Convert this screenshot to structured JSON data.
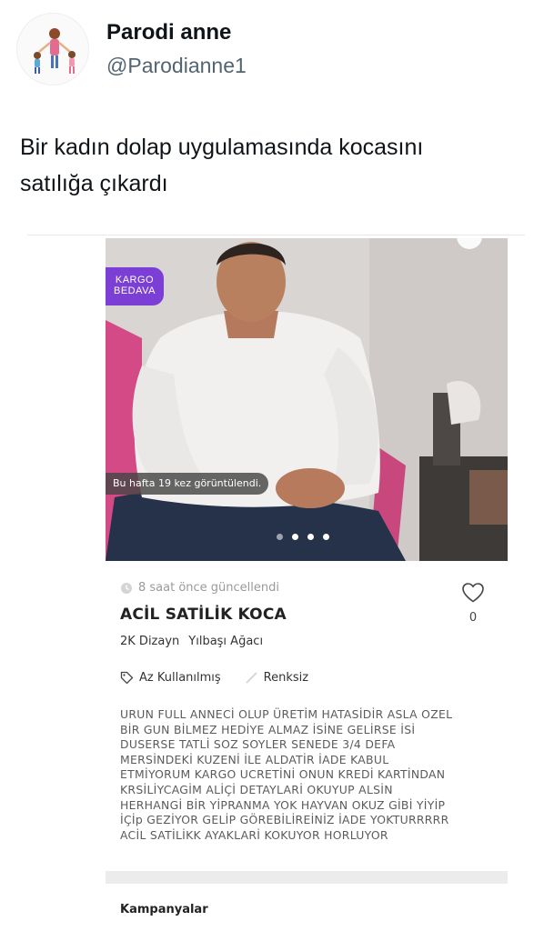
{
  "tweet": {
    "display_name": "Parodi anne",
    "handle": "@Parodianne1",
    "text_line1": "Bir kadın dolap uygulamasında kocasını",
    "text_line2": "satılığa çıkardı"
  },
  "listing": {
    "badge_line1": "KARGO",
    "badge_line2": "BEDAVA",
    "views_text": "Bu hafta 19 kez görüntülendi.",
    "photo_index": 4,
    "photo_count": 4,
    "updated_text": "8 saat önce güncellendi",
    "title": "ACİL SATİLİK KOCA",
    "favorite_count": "0",
    "size": "2K Dizayn",
    "category": "Yılbaşı Ağacı",
    "condition": "Az Kullanılmış",
    "color": "Renksiz",
    "description_lines": [
      "URUN FULL ANNECİ OLUP ÜRETİM HATASİDİR ASLA OZEL",
      "BİR GUN BİLMEZ HEDİYE ALMAZ İSİNE GELİRSE İSİ",
      "DUSERSE TATLİ SOZ SOYLER SENEDE 3/4 DEFA",
      "MERSİNDEKİ KUZENİ İLE ALDATİR İADE KABUL",
      "ETMİYORUM KARGO UCRETİNİ ONUN KREDİ KARTİNDAN",
      "KRSİLİYCAGİM ALİÇİ DETAYLARİ OKUYUP ALSİN",
      "HERHANGİ BİR YİPRANMA YOK HAYVAN OKUZ GİBİ YİYİP",
      "İÇİp GEZİYOR GELİP GÖREBİLİREİNİZ İADE YOKTURRRRR",
      "ACİL SATİLİKK AYAKLARİ KOKUYOR HORLUYOR"
    ],
    "campaigns_heading": "Kampanyalar"
  },
  "colors": {
    "badge_purple": "#7b3fd6",
    "handle_gray": "#536471"
  },
  "icons": {
    "clock": "clock-icon",
    "heart": "heart-icon",
    "tag": "tag-icon",
    "color": "slash-icon"
  }
}
